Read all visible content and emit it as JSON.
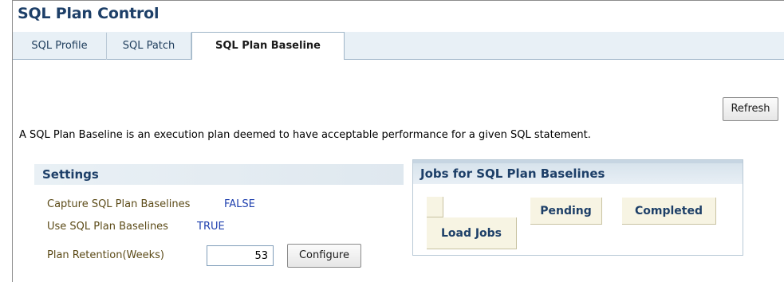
{
  "page": {
    "title": "SQL Plan Control"
  },
  "tabs": [
    {
      "label": "SQL Profile",
      "active": false
    },
    {
      "label": "SQL Patch",
      "active": false
    },
    {
      "label": "SQL Plan Baseline",
      "active": true
    }
  ],
  "toolbar": {
    "refresh_label": "Refresh"
  },
  "description": "A SQL Plan Baseline is an execution plan deemed to have acceptable performance for a given SQL statement.",
  "settings": {
    "header": "Settings",
    "capture_label": "Capture SQL Plan Baselines",
    "capture_value": "FALSE",
    "use_label": "Use SQL Plan Baselines",
    "use_value": "TRUE",
    "retention_label": "Plan Retention(Weeks)",
    "retention_value": "53",
    "configure_label": "Configure"
  },
  "jobs": {
    "header": "Jobs for SQL Plan Baselines",
    "load_jobs_label": "Load Jobs",
    "pending_label": "Pending",
    "completed_label": "Completed"
  },
  "colors": {
    "title": "#1d3f68",
    "value_link": "#1e3fae",
    "label_text": "#5c4b18",
    "tab_bar": "#e8f0f6",
    "jobs_cell": "#f7f4e3"
  }
}
